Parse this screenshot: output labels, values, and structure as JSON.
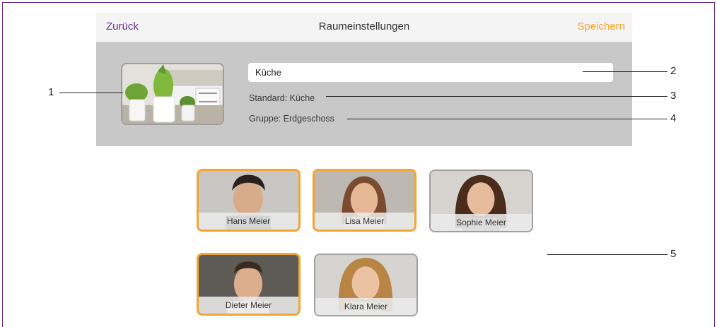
{
  "nav": {
    "back_label": "Zurück",
    "title": "Raumeinstellungen",
    "save_label": "Speichern"
  },
  "room": {
    "name_value": "Küche",
    "standard_text": "Standard: Küche",
    "group_text": "Gruppe: Erdgeschoss"
  },
  "callouts": [
    "1",
    "2",
    "3",
    "4",
    "5"
  ],
  "persons": [
    {
      "name": "Hans Meier",
      "selected": true
    },
    {
      "name": "Lisa Meier",
      "selected": true
    },
    {
      "name": "Sophie Meier",
      "selected": false
    },
    {
      "name": "Dieter Meier",
      "selected": true
    },
    {
      "name": "Klara Meier",
      "selected": false
    }
  ],
  "colors": {
    "accent_purple": "#6b2f8b",
    "accent_orange": "#f2a533",
    "panel_gray": "#c8c8c8"
  }
}
